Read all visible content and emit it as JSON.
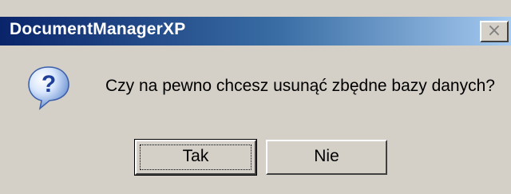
{
  "window": {
    "title": "DocumentManagerXP",
    "close_label": "×"
  },
  "dialog": {
    "icon": "question-icon",
    "message": "Czy na pewno chcesz usunąć zbędne bazy danych?",
    "buttons": {
      "yes_label": "Tak",
      "no_label": "Nie"
    }
  },
  "colors": {
    "titlebar_start": "#0a246a",
    "titlebar_end": "#a6caf0",
    "dialog_bg": "#d4d0c8"
  }
}
